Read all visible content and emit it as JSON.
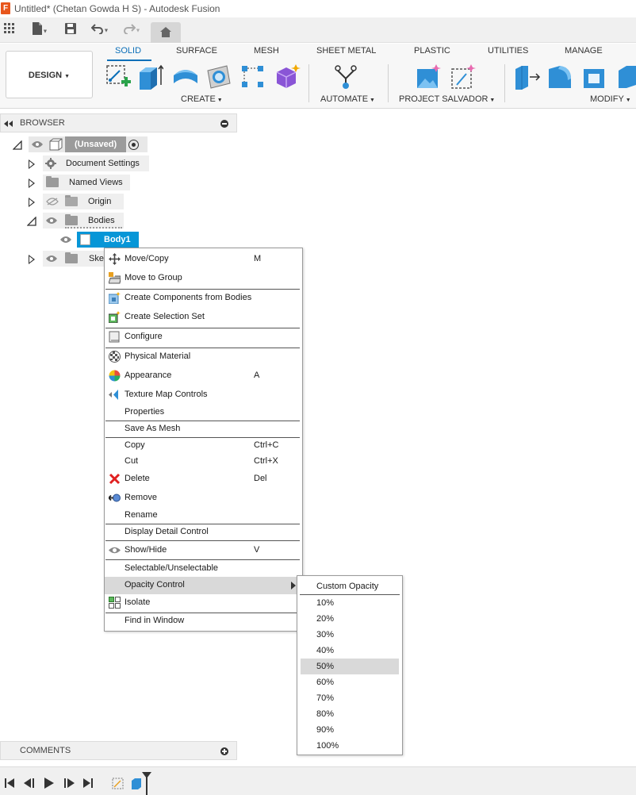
{
  "window": {
    "title": "Untitled* (Chetan Gowda H S) - Autodesk Fusion",
    "app_icon_letter": "F"
  },
  "ribbon": {
    "workspace_button": "DESIGN",
    "tabs": [
      {
        "label": "SOLID",
        "active": true
      },
      {
        "label": "SURFACE",
        "active": false
      },
      {
        "label": "MESH",
        "active": false
      },
      {
        "label": "SHEET METAL",
        "active": false
      },
      {
        "label": "PLASTIC",
        "active": false
      },
      {
        "label": "UTILITIES",
        "active": false
      },
      {
        "label": "MANAGE",
        "active": false
      }
    ],
    "groups": {
      "create": "CREATE",
      "automate": "AUTOMATE",
      "project_salvador": "PROJECT SALVADOR",
      "modify": "MODIFY"
    },
    "accent_color": "#0b6fb8"
  },
  "browser": {
    "title": "BROWSER",
    "root": "(Unsaved)",
    "items": [
      {
        "label": "Document Settings",
        "icon": "gear-icon"
      },
      {
        "label": "Named Views",
        "icon": "folder-icon"
      },
      {
        "label": "Origin",
        "icon": "folder-icon",
        "hidden": true
      },
      {
        "label": "Bodies",
        "icon": "folder-icon",
        "expanded": true
      },
      {
        "label": "Body1",
        "icon": "body-icon",
        "selected": true
      },
      {
        "label": "Ske",
        "icon": "folder-icon"
      }
    ],
    "selection_color": "#0696d7"
  },
  "context_menu": {
    "items": [
      {
        "label": "Move/Copy",
        "shortcut": "M",
        "icon": "move-icon"
      },
      {
        "label": "Move to Group",
        "shortcut": "",
        "icon": "move-to-group-icon"
      },
      {
        "label": "Create Components from Bodies",
        "shortcut": "",
        "icon": "create-components-icon"
      },
      {
        "label": "Create Selection Set",
        "shortcut": "",
        "icon": "selection-set-icon"
      },
      {
        "label": "Configure",
        "shortcut": "",
        "icon": "configure-icon"
      },
      {
        "label": "Physical Material",
        "shortcut": "",
        "icon": "physical-material-icon"
      },
      {
        "label": "Appearance",
        "shortcut": "A",
        "icon": "appearance-icon"
      },
      {
        "label": "Texture Map Controls",
        "shortcut": "",
        "icon": "texture-map-icon"
      },
      {
        "label": "Properties",
        "shortcut": ""
      },
      {
        "label": "Save As Mesh",
        "shortcut": ""
      },
      {
        "label": "Copy",
        "shortcut": "Ctrl+C"
      },
      {
        "label": "Cut",
        "shortcut": "Ctrl+X"
      },
      {
        "label": "Delete",
        "shortcut": "Del",
        "icon": "delete-icon"
      },
      {
        "label": "Remove",
        "shortcut": "",
        "icon": "remove-icon"
      },
      {
        "label": "Rename",
        "shortcut": ""
      },
      {
        "label": "Display Detail Control",
        "shortcut": ""
      },
      {
        "label": "Show/Hide",
        "shortcut": "V",
        "icon": "eye-icon"
      },
      {
        "label": "Selectable/Unselectable",
        "shortcut": ""
      },
      {
        "label": "Opacity Control",
        "shortcut": "",
        "has_submenu": true,
        "highlighted": true
      },
      {
        "label": "Isolate",
        "shortcut": "",
        "icon": "isolate-icon"
      },
      {
        "label": "Find in Window",
        "shortcut": ""
      }
    ]
  },
  "opacity_submenu": {
    "header": "Custom Opacity",
    "options": [
      "10%",
      "20%",
      "30%",
      "40%",
      "50%",
      "60%",
      "70%",
      "80%",
      "90%",
      "100%"
    ],
    "highlighted": "50%"
  },
  "comments": {
    "title": "COMMENTS"
  }
}
